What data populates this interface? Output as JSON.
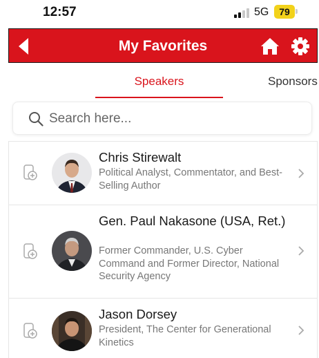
{
  "status_bar": {
    "time": "12:57",
    "network": "5G",
    "battery": "79"
  },
  "header": {
    "title": "My Favorites",
    "accent_color": "#d9141c"
  },
  "tabs": [
    {
      "label": "Speakers",
      "active": true
    },
    {
      "label": "Sponsors",
      "active": false
    }
  ],
  "search": {
    "placeholder": "Search here...",
    "value": ""
  },
  "speakers": [
    {
      "name": "Chris Stirewalt",
      "title": "Political Analyst, Commentator, and Best-Selling Author"
    },
    {
      "name": "Gen. Paul Nakasone (USA, Ret.)",
      "title": "Former Commander, U.S. Cyber Command and Former Director, National Security Agency"
    },
    {
      "name": "Jason Dorsey",
      "title": "President, The Center for Generational Kinetics"
    }
  ],
  "icons": {
    "back": "back-arrow-icon",
    "home": "home-icon",
    "settings": "gear-icon",
    "search": "search-icon",
    "add_calendar": "add-calendar-icon",
    "chevron": "chevron-right-icon"
  }
}
